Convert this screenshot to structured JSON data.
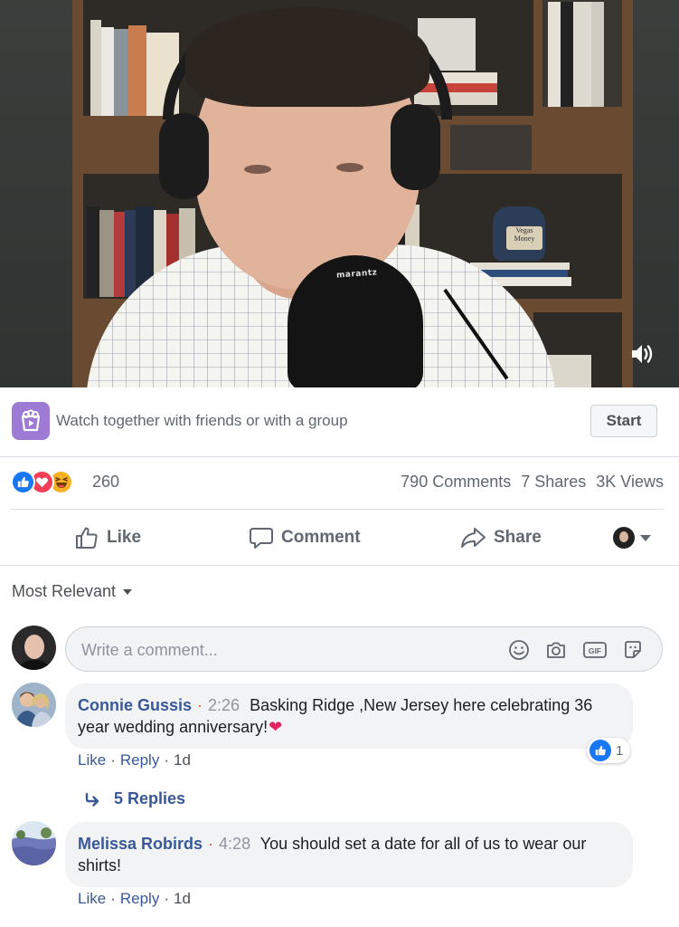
{
  "video": {
    "mic_brand": "marantz",
    "jar_text": "Vegas Money",
    "sound_icon": "speaker-volume-icon"
  },
  "watch_party": {
    "icon": "watch-party-icon",
    "text": "Watch together with friends or with a group",
    "start_label": "Start",
    "accent": "#9d7ad3"
  },
  "stats": {
    "reactions": [
      "like",
      "love",
      "haha"
    ],
    "reaction_count": "260",
    "comments": "790 Comments",
    "shares": "7 Shares",
    "views": "3K Views"
  },
  "actions": {
    "like": "Like",
    "comment": "Comment",
    "share": "Share"
  },
  "sort": {
    "label": "Most Relevant"
  },
  "composer": {
    "placeholder": "Write a comment...",
    "icons": [
      "emoji-icon",
      "camera-icon",
      "gif-icon",
      "sticker-icon"
    ]
  },
  "comments": [
    {
      "author": "Connie Gussis",
      "timestamp": "2:26",
      "text": "Basking Ridge ,New Jersey here celebrating 36 year wedding anniversary!",
      "emoji": "❤",
      "like_label": "Like",
      "reply_label": "Reply",
      "age": "1d",
      "reaction_count": "1",
      "replies": "5 Replies"
    },
    {
      "author": "Melissa Robirds",
      "timestamp": "4:28",
      "text": "You should set a date for all of us to wear our shirts!",
      "like_label": "Like",
      "reply_label": "Reply",
      "age": "1d"
    }
  ],
  "colors": {
    "link": "#385898",
    "like_blue": "#1877f2",
    "love_red": "#f33e58",
    "haha_yellow": "#f7b125",
    "timestamp_dot": "#e4553a"
  }
}
